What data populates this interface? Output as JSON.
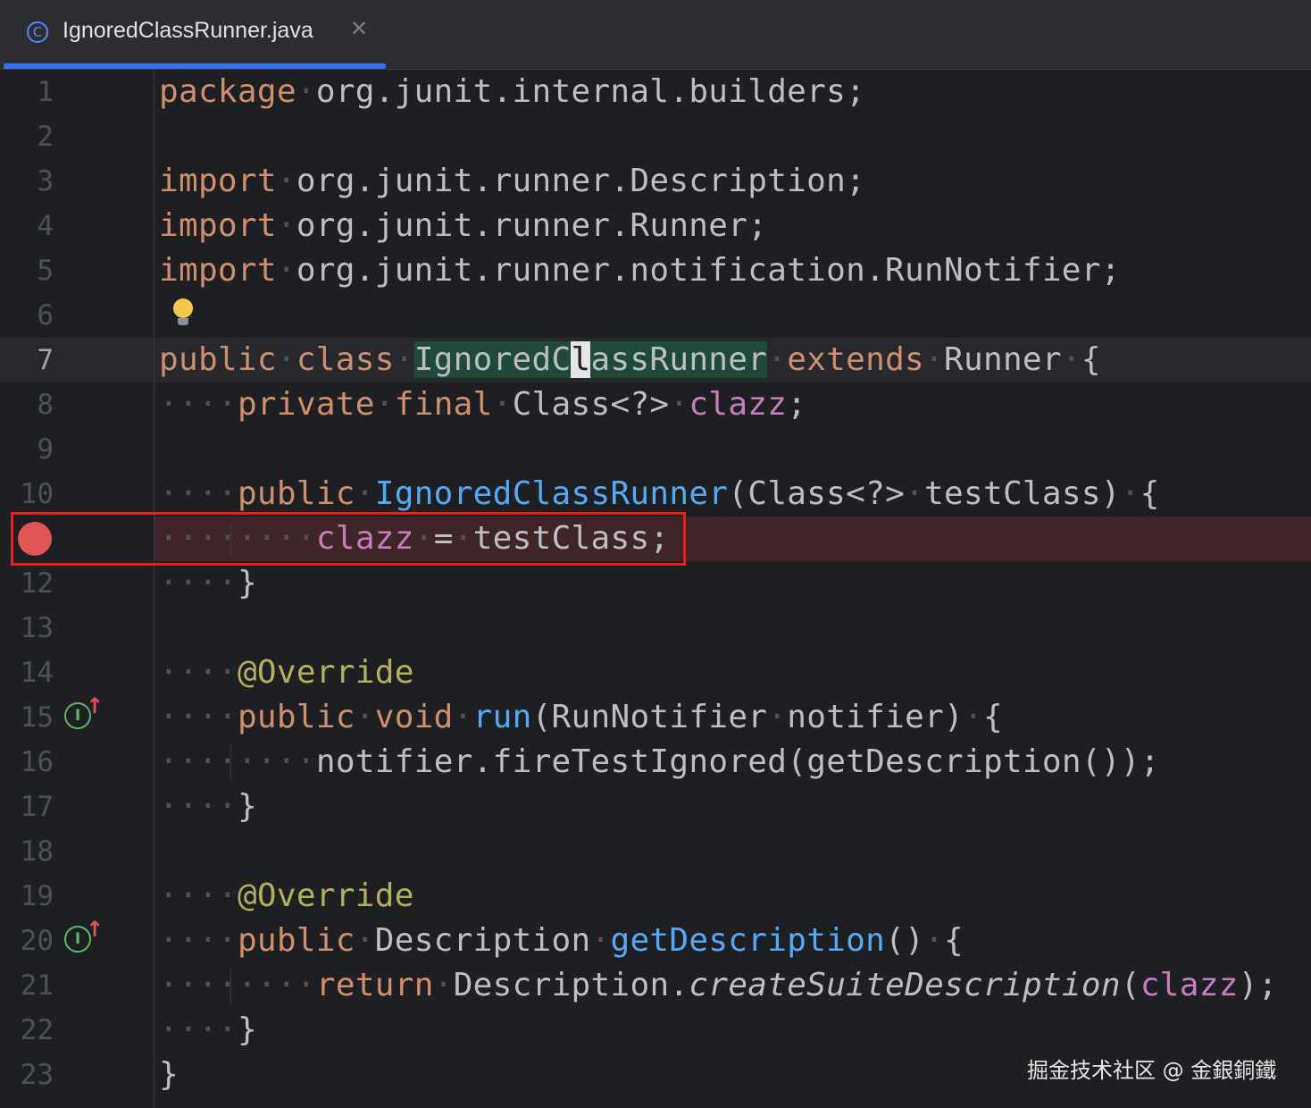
{
  "tab": {
    "label": "IgnoredClassRunner.java",
    "icon": "class-c-icon",
    "accent": "#3574f0"
  },
  "lines": [
    {
      "n": "1",
      "t": "package·org.junit.internal.builders;"
    },
    {
      "n": "2",
      "t": ""
    },
    {
      "n": "3",
      "t": "import·org.junit.runner.Description;"
    },
    {
      "n": "4",
      "t": "import·org.junit.runner.Runner;"
    },
    {
      "n": "5",
      "t": "import·org.junit.runner.notification.RunNotifier;"
    },
    {
      "n": "6",
      "t": ""
    },
    {
      "n": "7",
      "t": "public·class·IgnoredClassRunner·extends·Runner·{"
    },
    {
      "n": "8",
      "t": "····private·final·Class<?>·clazz;"
    },
    {
      "n": "9",
      "t": ""
    },
    {
      "n": "10",
      "t": "····public·IgnoredClassRunner(Class<?>·testClass)·{"
    },
    {
      "n": "11",
      "t": "········clazz·=·testClass;"
    },
    {
      "n": "12",
      "t": "····}"
    },
    {
      "n": "13",
      "t": ""
    },
    {
      "n": "14",
      "t": "····@Override"
    },
    {
      "n": "15",
      "t": "····public·void·run(RunNotifier·notifier)·{"
    },
    {
      "n": "16",
      "t": "········notifier.fireTestIgnored(getDescription());"
    },
    {
      "n": "17",
      "t": "····}"
    },
    {
      "n": "18",
      "t": ""
    },
    {
      "n": "19",
      "t": "····@Override"
    },
    {
      "n": "20",
      "t": "····public·Description·getDescription()·{"
    },
    {
      "n": "21",
      "t": "········return·Description.createSuiteDescription(clazz);"
    },
    {
      "n": "22",
      "t": "····}"
    },
    {
      "n": "23",
      "t": "}"
    }
  ],
  "current_line": 7,
  "breakpoint_line": 11,
  "implements_marker_lines": [
    15,
    20
  ],
  "watermark": "掘金技术社区 @ 金銀銅鐵",
  "colors": {
    "keyword": "#cf8e6d",
    "field": "#c77dbb",
    "method": "#56a8f5",
    "annotation": "#b3ae60",
    "breakpoint": "#e05555"
  }
}
